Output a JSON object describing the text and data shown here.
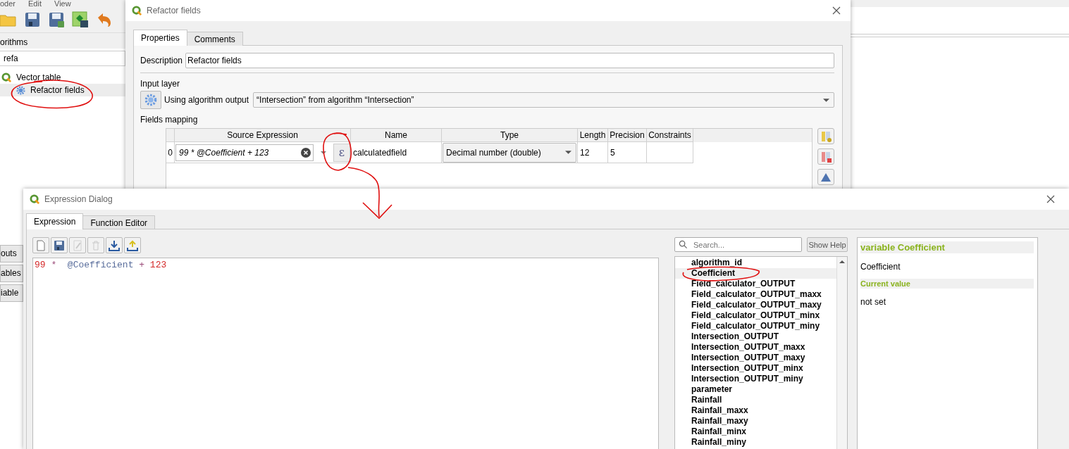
{
  "background_app": {
    "menu": [
      "oder",
      "Edit",
      "View"
    ],
    "toolbar": [
      {
        "kind": "folder"
      },
      {
        "kind": "save"
      },
      {
        "kind": "save-as"
      },
      {
        "kind": "export"
      },
      {
        "kind": "undo"
      }
    ],
    "panel_title": "orithms",
    "search": {
      "value": "refa"
    },
    "tree": [
      {
        "label": "Vector table",
        "children": [
          {
            "label": "Refactor fields",
            "selected": true
          }
        ]
      }
    ],
    "side_tabs": [
      "outs",
      "ables",
      "iable"
    ]
  },
  "refactor_window": {
    "title": "Refactor fields",
    "tabs": [
      {
        "label": "Properties",
        "selected": true
      },
      {
        "label": "Comments",
        "selected": false
      }
    ],
    "description": {
      "label": "Description",
      "value": "Refactor fields"
    },
    "input_layer": {
      "label": "Input layer",
      "mode": "Using algorithm output",
      "value": "“Intersection” from algorithm “Intersection”"
    },
    "fields_mapping": {
      "label": "Fields mapping",
      "columns": [
        "Source Expression",
        "Name",
        "Type",
        "Length",
        "Precision",
        "Constraints"
      ],
      "rows": [
        {
          "index": "0",
          "expression": "99 * @Coefficient + 123",
          "expression_button": "ε",
          "name": "calculatedfield",
          "type": "Decimal number (double)",
          "length": "12",
          "precision": "5"
        }
      ]
    }
  },
  "expression_dialog": {
    "title": "Expression Dialog",
    "tabs": [
      {
        "label": "Expression",
        "selected": true
      },
      {
        "label": "Function Editor",
        "selected": false
      }
    ],
    "toolbar": [
      {
        "kind": "new",
        "disabled": false
      },
      {
        "kind": "save",
        "disabled": false
      },
      {
        "kind": "edit",
        "disabled": true
      },
      {
        "kind": "delete",
        "disabled": true
      },
      {
        "kind": "import",
        "disabled": false
      },
      {
        "kind": "export",
        "disabled": false
      }
    ],
    "expression_tokens": [
      {
        "text": "99",
        "kind": "number"
      },
      {
        "text": " *  ",
        "kind": "operator"
      },
      {
        "text": "@Coefficient",
        "kind": "variable"
      },
      {
        "text": " + ",
        "kind": "operator"
      },
      {
        "text": "123",
        "kind": "number"
      }
    ],
    "search": {
      "placeholder": "Search..."
    },
    "show_help_button": "Show Help",
    "variables": [
      {
        "label": "algorithm_id",
        "selected": false
      },
      {
        "label": "Coefficient",
        "selected": true
      },
      {
        "label": "Field_calculator_OUTPUT",
        "selected": false
      },
      {
        "label": "Field_calculator_OUTPUT_maxx",
        "selected": false
      },
      {
        "label": "Field_calculator_OUTPUT_maxy",
        "selected": false
      },
      {
        "label": "Field_calculator_OUTPUT_minx",
        "selected": false
      },
      {
        "label": "Field_calculator_OUTPUT_miny",
        "selected": false
      },
      {
        "label": "Intersection_OUTPUT",
        "selected": false
      },
      {
        "label": "Intersection_OUTPUT_maxx",
        "selected": false
      },
      {
        "label": "Intersection_OUTPUT_maxy",
        "selected": false
      },
      {
        "label": "Intersection_OUTPUT_minx",
        "selected": false
      },
      {
        "label": "Intersection_OUTPUT_miny",
        "selected": false
      },
      {
        "label": "parameter",
        "selected": false
      },
      {
        "label": "Rainfall",
        "selected": false
      },
      {
        "label": "Rainfall_maxx",
        "selected": false
      },
      {
        "label": "Rainfall_maxy",
        "selected": false
      },
      {
        "label": "Rainfall_minx",
        "selected": false
      },
      {
        "label": "Rainfall_miny",
        "selected": false
      }
    ],
    "help": {
      "title": "variable Coefficient",
      "name": "Coefficient",
      "value_heading": "Current value",
      "value": "not set"
    }
  }
}
